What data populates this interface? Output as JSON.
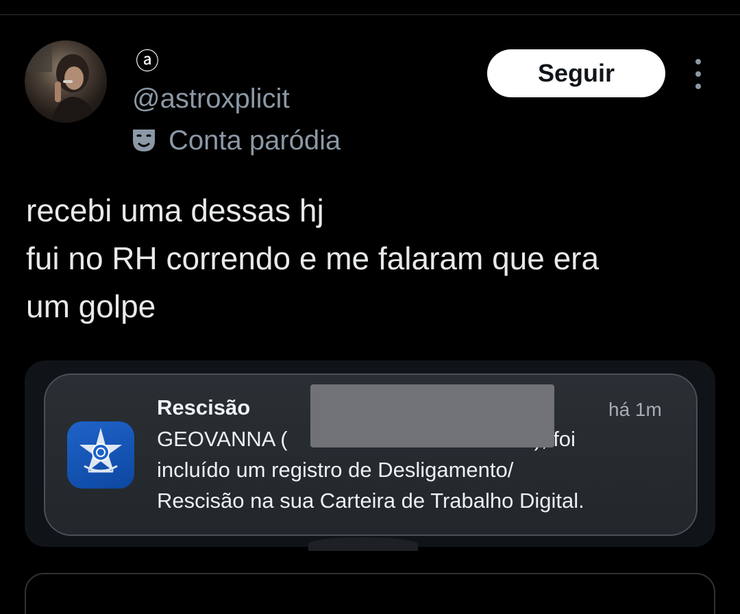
{
  "post": {
    "display_name_symbol": "ⓐ",
    "handle": "@astroxplicit",
    "parody_label": "Conta paródia",
    "follow_label": "Seguir",
    "text_lines": [
      "recebi uma dessas hj",
      "fui no RH correndo e me falaram que era",
      "um golpe"
    ]
  },
  "notification": {
    "app_icon": "brazil-coat-of-arms-icon",
    "title": "Rescisão",
    "time": "há 1m",
    "body_lines": [
      "GEOVANNA (",
      "), foi",
      "incluído um registro de Desligamento/",
      "Rescisão na sua Carteira de Trabalho Digital."
    ]
  },
  "colors": {
    "background": "#000000",
    "text_primary": "#e7e9ea",
    "text_secondary": "#8b98a5",
    "follow_button_bg": "#ffffff",
    "app_icon_blue": "#1f63c9"
  }
}
